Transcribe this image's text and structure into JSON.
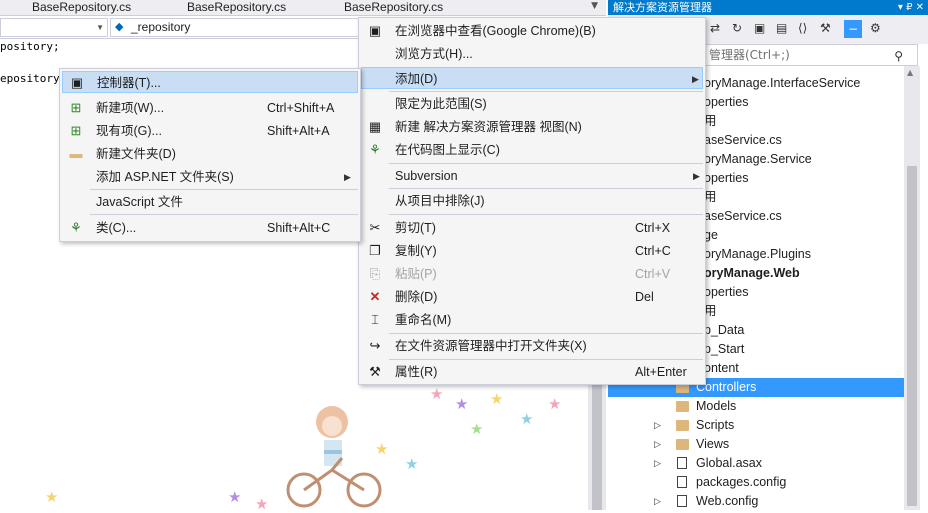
{
  "tabs": [
    "BaseRepository.cs",
    "BaseRepository.cs",
    "BaseRepository.cs"
  ],
  "navbar": {
    "member_combo": "_repository"
  },
  "code": {
    "line1": "pository;",
    "line2": "epository"
  },
  "solution_explorer": {
    "title": "解决方案资源管理器",
    "title_buttons": "▾ ₽ ✕",
    "search_placeholder": "管理器(Ctrl+;)",
    "items": [
      {
        "label": "oryManage.InterfaceService"
      },
      {
        "label": "operties"
      },
      {
        "label": "用"
      },
      {
        "label": "aseService.cs"
      },
      {
        "label": "oryManage.Service"
      },
      {
        "label": "operties"
      },
      {
        "label": "用"
      },
      {
        "label": "aseService.cs"
      },
      {
        "label": "ge"
      },
      {
        "label": "oryManage.Plugins"
      },
      {
        "label": "oryManage.Web"
      },
      {
        "label": "operties"
      },
      {
        "label": "用"
      },
      {
        "label": "p_Data"
      },
      {
        "label": "p_Start"
      },
      {
        "label": "ontent"
      },
      {
        "label": "Controllers"
      },
      {
        "label": "Models"
      },
      {
        "label": "Scripts"
      },
      {
        "label": "Views"
      },
      {
        "label": "Global.asax"
      },
      {
        "label": "packages.config"
      },
      {
        "label": "Web.config"
      }
    ]
  },
  "main_menu": {
    "items": [
      {
        "icon": "browser-icon",
        "label": "在浏览器中查看(Google Chrome)(B)",
        "shortcut": ""
      },
      {
        "icon": "",
        "label": "浏览方式(H)...",
        "shortcut": ""
      },
      {
        "icon": "",
        "label": "添加(D)",
        "shortcut": ""
      },
      {
        "icon": "",
        "label": "限定为此范围(S)",
        "shortcut": ""
      },
      {
        "icon": "new-view-icon",
        "label": "新建 解决方案资源管理器 视图(N)",
        "shortcut": ""
      },
      {
        "icon": "class-diagram-icon",
        "label": "在代码图上显示(C)",
        "shortcut": ""
      },
      {
        "icon": "",
        "label": "Subversion",
        "shortcut": ""
      },
      {
        "icon": "",
        "label": "从项目中排除(J)",
        "shortcut": ""
      },
      {
        "icon": "cut-icon",
        "label": "剪切(T)",
        "shortcut": "Ctrl+X"
      },
      {
        "icon": "copy-icon",
        "label": "复制(Y)",
        "shortcut": "Ctrl+C"
      },
      {
        "icon": "paste-icon",
        "label": "粘贴(P)",
        "shortcut": "Ctrl+V"
      },
      {
        "icon": "delete-icon",
        "label": "删除(D)",
        "shortcut": "Del"
      },
      {
        "icon": "rename-icon",
        "label": "重命名(M)",
        "shortcut": ""
      },
      {
        "icon": "open-folder-icon",
        "label": "在文件资源管理器中打开文件夹(X)",
        "shortcut": ""
      },
      {
        "icon": "wrench-icon",
        "label": "属性(R)",
        "shortcut": "Alt+Enter"
      }
    ]
  },
  "sub_menu": {
    "items": [
      {
        "icon": "controller-icon",
        "label": "控制器(T)...",
        "shortcut": ""
      },
      {
        "icon": "new-item-icon",
        "label": "新建项(W)...",
        "shortcut": "Ctrl+Shift+A"
      },
      {
        "icon": "existing-item-icon",
        "label": "现有项(G)...",
        "shortcut": "Shift+Alt+A"
      },
      {
        "icon": "new-folder-icon",
        "label": "新建文件夹(D)",
        "shortcut": ""
      },
      {
        "icon": "",
        "label": "添加 ASP.NET 文件夹(S)",
        "shortcut": ""
      },
      {
        "icon": "",
        "label": "JavaScript 文件",
        "shortcut": ""
      },
      {
        "icon": "class-icon",
        "label": "类(C)...",
        "shortcut": "Shift+Alt+C"
      }
    ]
  },
  "colors": {
    "accent": "#007acc",
    "selection": "#3399ff",
    "menu_highlight": "#c9def5",
    "menu_bg": "#f5f5f5"
  }
}
